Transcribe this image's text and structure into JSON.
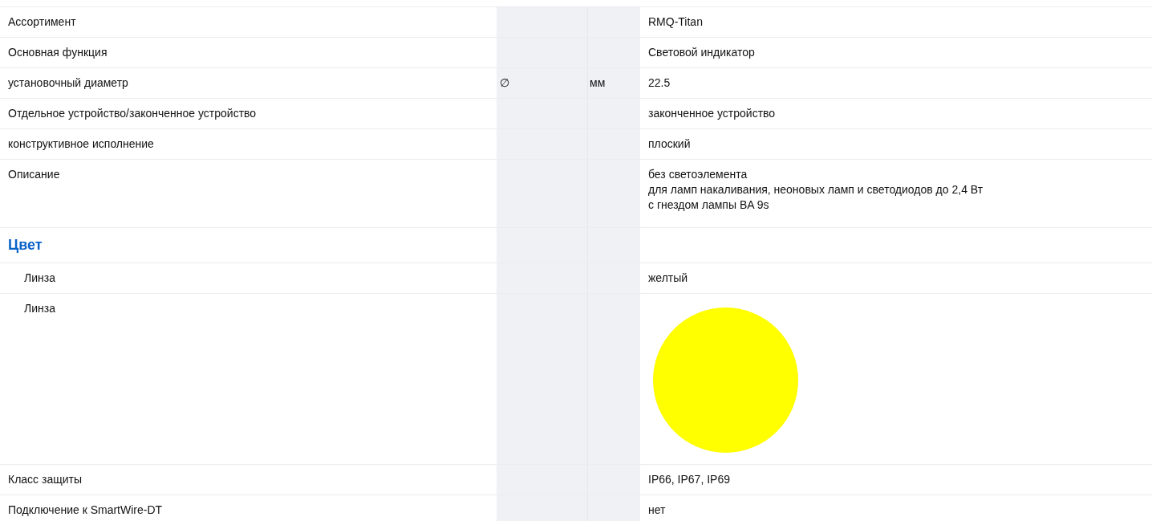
{
  "rows": [
    {
      "kind": "property",
      "label": "Ассортимент",
      "value": [
        "RMQ-Titan"
      ]
    },
    {
      "kind": "property",
      "label": "Основная функция",
      "value": [
        "Световой индикатор"
      ]
    },
    {
      "kind": "property",
      "label": "установочный диаметр",
      "symbol": "∅",
      "unit": "мм",
      "value": [
        "22.5"
      ]
    },
    {
      "kind": "property",
      "label": "Отдельное устройство/законченное устройство",
      "value": [
        "законченное устройство"
      ]
    },
    {
      "kind": "property",
      "label": "конструктивное исполнение",
      "value": [
        "плоский"
      ]
    },
    {
      "kind": "property",
      "label": "Описание",
      "value": [
        "без светоэлемента",
        "для ламп накаливания, неоновых ламп и светодиодов до 2,4 Вт",
        "с гнездом лампы BA 9s"
      ]
    },
    {
      "kind": "heading",
      "label": "Цвет",
      "children": [
        {
          "kind": "property",
          "label": "Линза",
          "value": [
            "желтый"
          ]
        },
        {
          "kind": "swatch",
          "label": "Линза",
          "color": "#ffff00"
        }
      ]
    },
    {
      "kind": "property",
      "label": "Класс защиты",
      "value": [
        "IP66, IP67, IP69"
      ]
    },
    {
      "kind": "property",
      "label": "Подключение к SmartWire-DT",
      "value": [
        "нет"
      ]
    }
  ]
}
